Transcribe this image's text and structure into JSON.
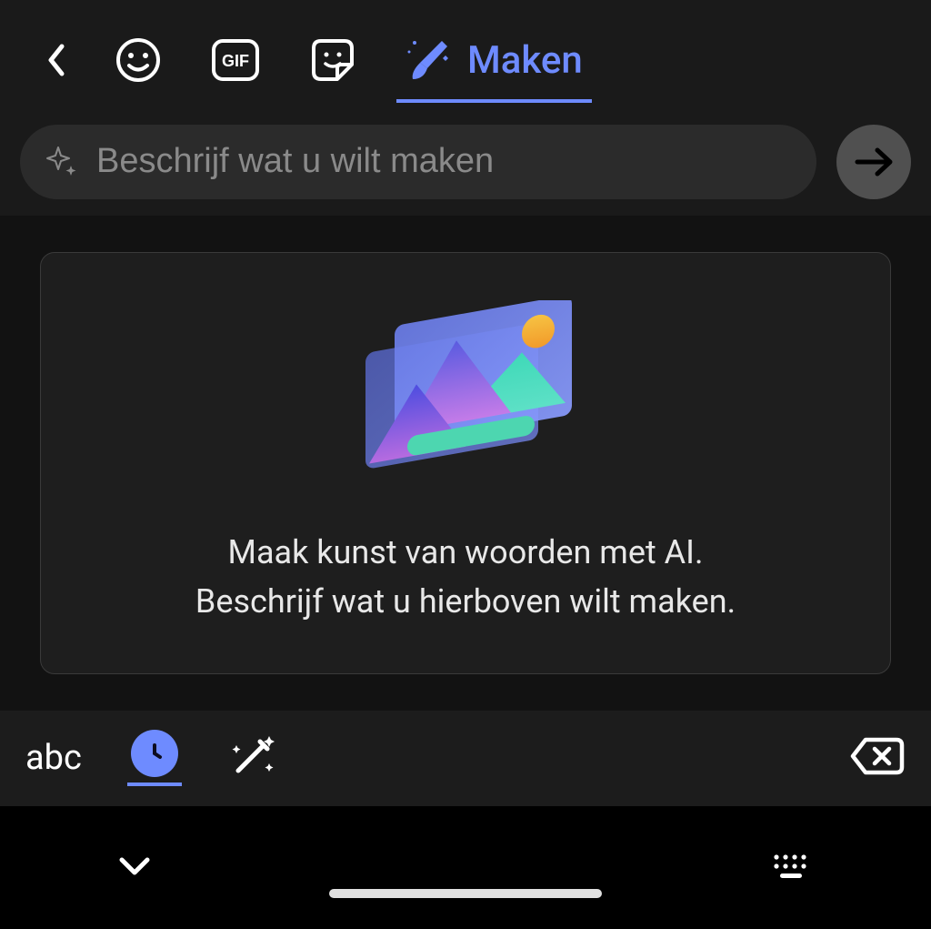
{
  "tabs": {
    "active_label": "Maken"
  },
  "search": {
    "placeholder": "Beschrijf wat u wilt maken"
  },
  "card": {
    "line1": "Maak kunst van woorden met AI.",
    "line2": "Beschrijf wat u hierboven wilt maken."
  },
  "toolbar": {
    "abc_label": "abc"
  }
}
